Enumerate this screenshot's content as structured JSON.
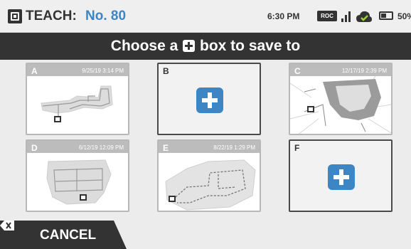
{
  "status_bar": {
    "title_label": "TEACH:",
    "title_number": "No. 80",
    "time": "6:30 PM",
    "roc_badge": "ROC",
    "battery_percent": "50%",
    "icons": [
      "app-logo-icon",
      "signal-icon",
      "cloud-check-icon",
      "battery-icon"
    ]
  },
  "header": {
    "prefix": "Choose a",
    "suffix": "box to save to"
  },
  "slots": [
    {
      "label": "A",
      "date": "9/25/19 3:14 PM",
      "state": "saved"
    },
    {
      "label": "B",
      "date": "",
      "state": "empty"
    },
    {
      "label": "C",
      "date": "12/17/19 2:39 PM",
      "state": "saved"
    },
    {
      "label": "D",
      "date": "6/12/19 12:09 PM",
      "state": "saved"
    },
    {
      "label": "E",
      "date": "8/22/19 1:29 PM",
      "state": "saved"
    },
    {
      "label": "F",
      "date": "",
      "state": "empty"
    }
  ],
  "footer": {
    "cancel_label": "CANCEL"
  },
  "colors": {
    "accent": "#3d86c6",
    "dark": "#333333",
    "background": "#ececec"
  }
}
